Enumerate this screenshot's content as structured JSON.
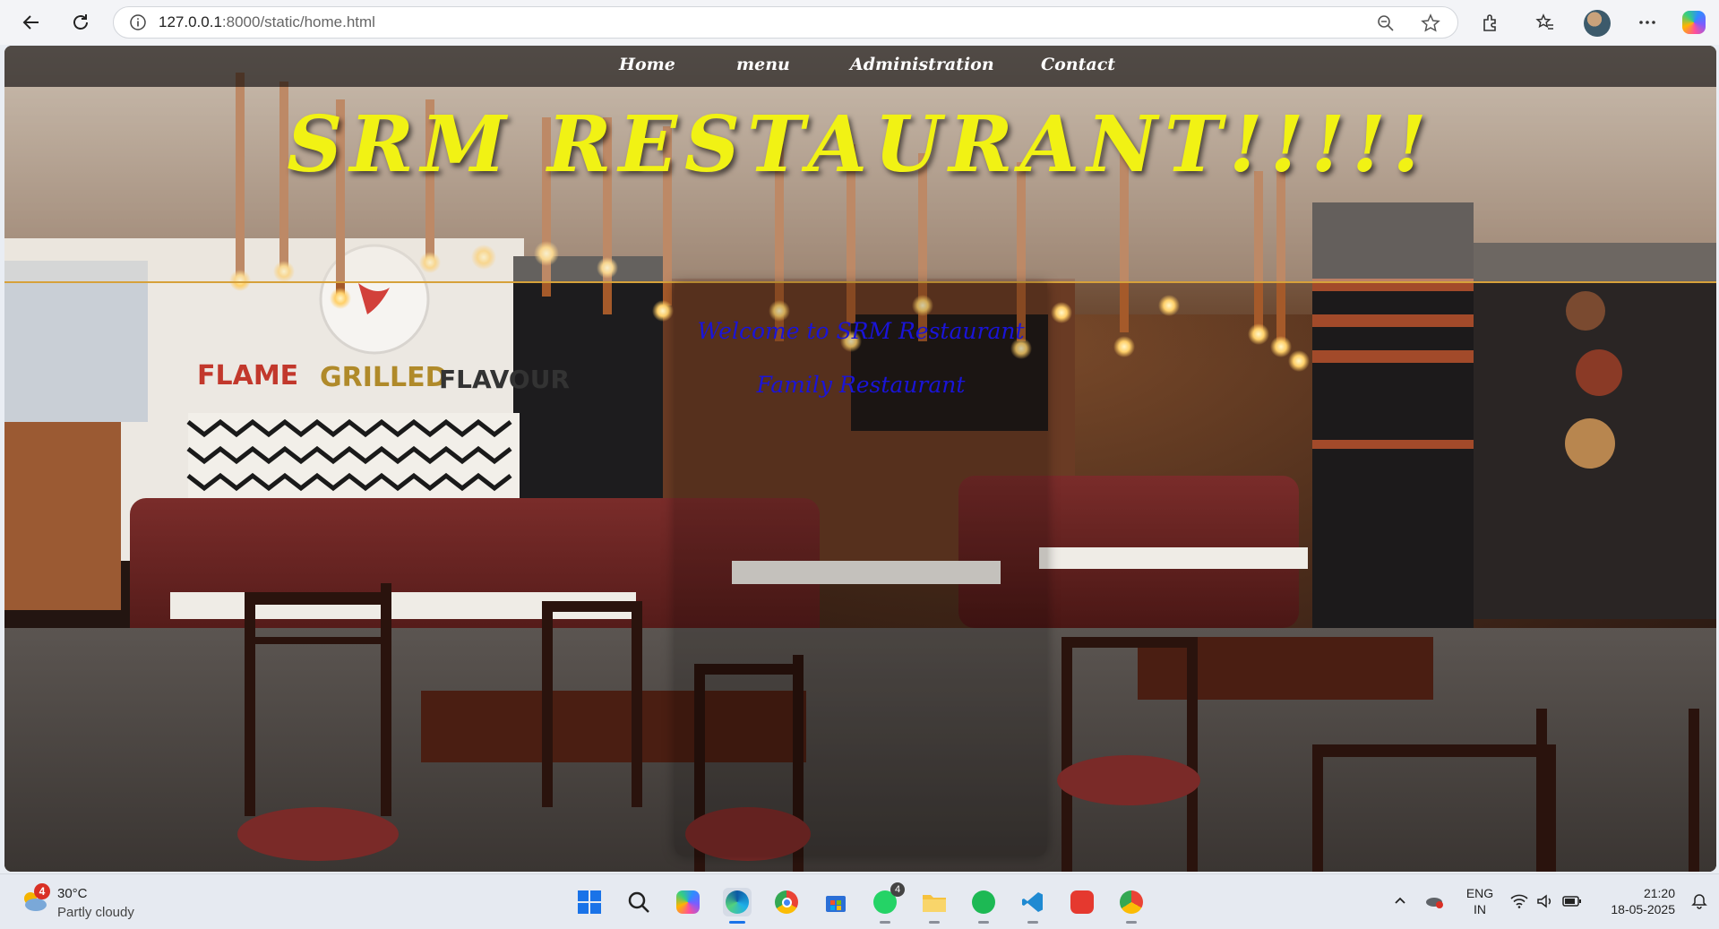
{
  "browser": {
    "url_host": "127.0.0.1",
    "url_path": ":8000/static/home.html"
  },
  "page": {
    "nav": [
      "Home",
      "menu",
      "Administration",
      "Contact"
    ],
    "title": "SRM RESTAURANT!!!!!",
    "welcome": "Welcome to SRM Restaurant",
    "subtitle": "Family Restaurant",
    "background_sign_text": [
      "FLAME",
      "GRILLED",
      "FLAVOUR"
    ]
  },
  "taskbar": {
    "weather_badge": "4",
    "temperature": "30°C",
    "condition": "Partly cloudy",
    "apps": [
      {
        "name": "windows-start-icon"
      },
      {
        "name": "search-icon"
      },
      {
        "name": "copilot-icon"
      },
      {
        "name": "edge-browser-icon"
      },
      {
        "name": "chrome-icon"
      },
      {
        "name": "microsoft-store-icon"
      },
      {
        "name": "whatsapp-icon",
        "badge": "4"
      },
      {
        "name": "file-explorer-icon"
      },
      {
        "name": "spotify-icon"
      },
      {
        "name": "vscode-icon"
      },
      {
        "name": "wps-office-icon"
      },
      {
        "name": "chrome-profile-icon"
      }
    ],
    "language_line1": "ENG",
    "language_line2": "IN",
    "time": "21:20",
    "date": "18-05-2025"
  },
  "colors": {
    "title": "#f1f214",
    "welcome_text": "#1a14d8",
    "nav_text": "#ffffff",
    "header_border": "#d6a13a"
  }
}
